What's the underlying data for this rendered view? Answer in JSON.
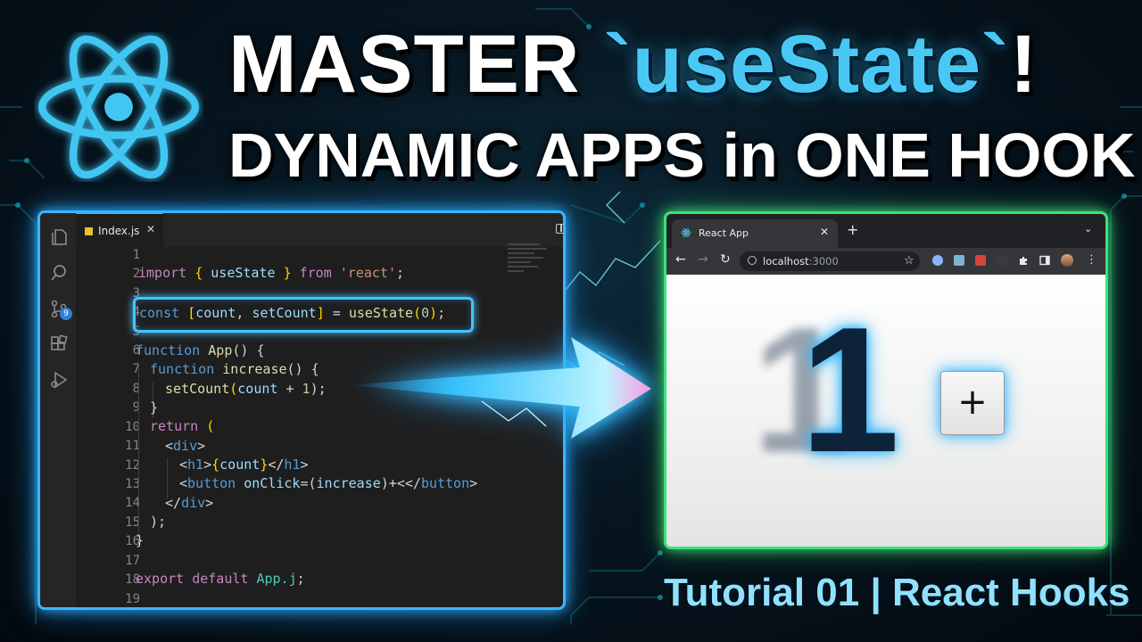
{
  "title": {
    "line1_prefix": "MASTER ",
    "line1_highlight": "`useState`",
    "line1_suffix": "!",
    "line2": "DYNAMIC APPS in ONE HOOK"
  },
  "logo": {
    "icon": "react-logo-icon",
    "color": "#41c6f2"
  },
  "editor": {
    "tab_label": "Index.js",
    "tab_close": "✕",
    "more_actions": "···",
    "activity_icons": [
      "explorer-icon",
      "search-icon",
      "source-control-icon",
      "extensions-icon",
      "run-debug-icon"
    ],
    "scm_badge": "9",
    "line_numbers": [
      "1",
      "2",
      "3",
      "4",
      "5",
      "6",
      "7",
      "8",
      "9",
      "10",
      "11",
      "12",
      "13",
      "14",
      "15",
      "16",
      "17",
      "18",
      "19"
    ],
    "code": {
      "l2": {
        "kw_import": "import",
        "brace_open": "{",
        "ident": " useState ",
        "brace_close": "}",
        "kw_from": "from",
        "str": "'react'",
        "semi": ";"
      },
      "l4": {
        "kw": "const",
        "br_open": "[",
        "a": "count",
        "comma": ", ",
        "b": "setCount",
        "br_close": "]",
        "eq": " = ",
        "fn": "useState",
        "p_open": "(",
        "num": "0",
        "p_close": ")",
        "semi": ";"
      },
      "l6": {
        "kw": "function",
        "fn": "App",
        "rest": "() {"
      },
      "l7": {
        "kw": "function",
        "fn": "increase",
        "rest": "() {"
      },
      "l8": {
        "fn": "setCount",
        "p_open": "(",
        "v": "count",
        "op": " + ",
        "num": "1",
        "rest": ");"
      },
      "l9": {
        "text": "}"
      },
      "l10": {
        "kw": "return",
        "rest": "("
      },
      "l11": {
        "tag_open": "<",
        "tag": "div",
        "tag_close": ">"
      },
      "l12": {
        "a": "<",
        "tag1": "h1",
        "b": ">",
        "brace1": "{",
        "v": "count",
        "brace2": "}",
        "c": "</",
        "tag2": "h1",
        "d": ">"
      },
      "l13": {
        "a": "<",
        "tag1": "button",
        "attr": "onClick",
        "eq": "=(",
        "v": "increase",
        "mid": ")+<</",
        "tag2": "button",
        "d": ">"
      },
      "l14": {
        "a": "</",
        "tag": "div",
        "b": ">"
      },
      "l15": {
        "text": ");"
      },
      "l16": {
        "text": "}"
      },
      "l18": {
        "kw1": "export",
        "kw2": "default",
        "cls": "App.j",
        "semi": ";"
      }
    }
  },
  "browser": {
    "tab_title": "React App",
    "tab_close": "✕",
    "new_tab": "+",
    "tab_dropdown": "⌄",
    "url_host": "localhost",
    "url_port": ":3000",
    "nav_back": "←",
    "nav_forward": "→",
    "nav_reload": "↻",
    "star": "☆",
    "menu": "⋮",
    "counter_value": "1",
    "counter_ghost": "1",
    "plus_label": "+"
  },
  "footer": "Tutorial 01 | React Hooks",
  "colors": {
    "accent_blue": "#3ab6ff",
    "accent_green": "#3ee07a",
    "title_highlight": "#49c8f5",
    "footer": "#8fe1ff"
  }
}
